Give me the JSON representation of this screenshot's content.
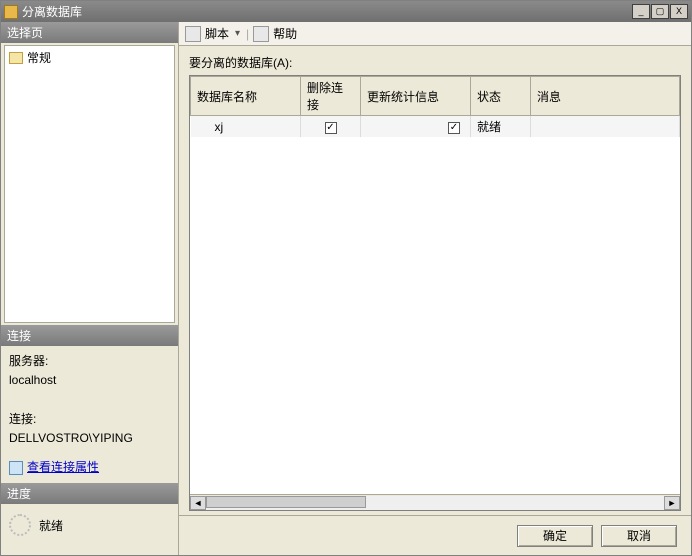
{
  "window": {
    "title": "分离数据库"
  },
  "left": {
    "pages_header": "选择页",
    "pages": [
      {
        "label": "常规"
      }
    ],
    "connection_header": "连接",
    "server_label": "服务器:",
    "server_value": "localhost",
    "conn_label": "连接:",
    "conn_value": "DELLVOSTRO\\YIPING",
    "view_conn_link": "查看连接属性",
    "progress_header": "进度",
    "progress_status": "就绪"
  },
  "toolbar": {
    "script": "脚本",
    "help": "帮助"
  },
  "main": {
    "grid_label": "要分离的数据库(A):",
    "columns": [
      "数据库名称",
      "删除连接",
      "更新统计信息",
      "状态",
      "消息"
    ],
    "rows": [
      {
        "db": "xj",
        "drop": true,
        "update": true,
        "status": "就绪",
        "message": ""
      }
    ]
  },
  "footer": {
    "ok": "确定",
    "cancel": "取消"
  }
}
